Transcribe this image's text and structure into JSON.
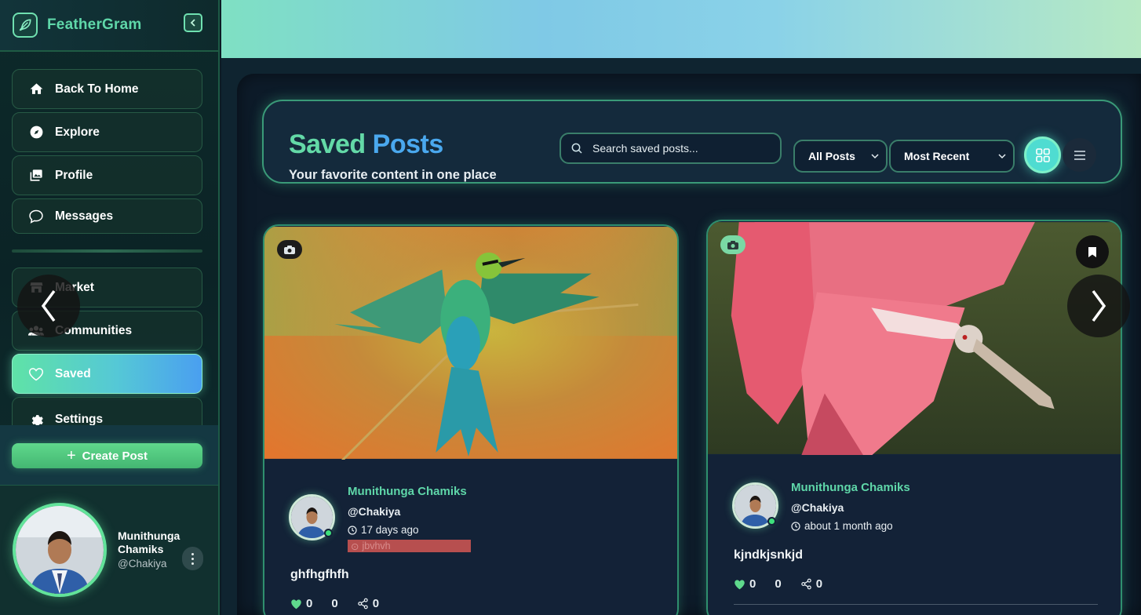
{
  "app": {
    "name": "FeatherGram"
  },
  "sidebar": {
    "items": [
      {
        "label": "Back To Home",
        "icon": "home-icon"
      },
      {
        "label": "Explore",
        "icon": "compass-icon"
      },
      {
        "label": "Profile",
        "icon": "images-icon"
      },
      {
        "label": "Messages",
        "icon": "chat-bubble-icon"
      },
      {
        "label": "Market",
        "icon": "store-icon"
      },
      {
        "label": "Communities",
        "icon": "users-icon"
      },
      {
        "label": "Saved",
        "icon": "heart-icon",
        "active": true
      },
      {
        "label": "Settings",
        "icon": "gear-icon"
      }
    ],
    "create_post_label": "Create Post",
    "user": {
      "name": "Munithunga Chamiks",
      "handle": "@Chakiya"
    }
  },
  "header": {
    "title_part1": "Saved",
    "title_part2": "Posts",
    "subtitle": "Your favorite content in one place",
    "search_placeholder": "Search saved posts...",
    "filter_selected": "All Posts",
    "sort_selected": "Most Recent",
    "view_mode": "grid"
  },
  "posts": [
    {
      "author": "Munithunga Chamiks",
      "handle": "@Chakiya",
      "time": "17 days ago",
      "location": "jbvhvh",
      "caption": "ghfhgfhfh",
      "likes": "0",
      "comments": "0",
      "shares": "0",
      "media_type": "photo",
      "image_subject": "green bee-eater bird with spread wings"
    },
    {
      "author": "Munithunga Chamiks",
      "handle": "@Chakiya",
      "time": "about 1 month ago",
      "caption": "kjndkjsnkjd",
      "likes": "0",
      "comments": "0",
      "shares": "0",
      "media_type": "photo",
      "saved": true,
      "image_subject": "pink roseate spoonbill with spread wings"
    }
  ],
  "carousel": {
    "prev_glyph": "❮",
    "next_glyph": "❯"
  },
  "colors": {
    "accent_green": "#5fd7a9",
    "accent_blue": "#4aa8ee",
    "panel_bg": "#0d1b29",
    "card_bg": "#13243a"
  }
}
